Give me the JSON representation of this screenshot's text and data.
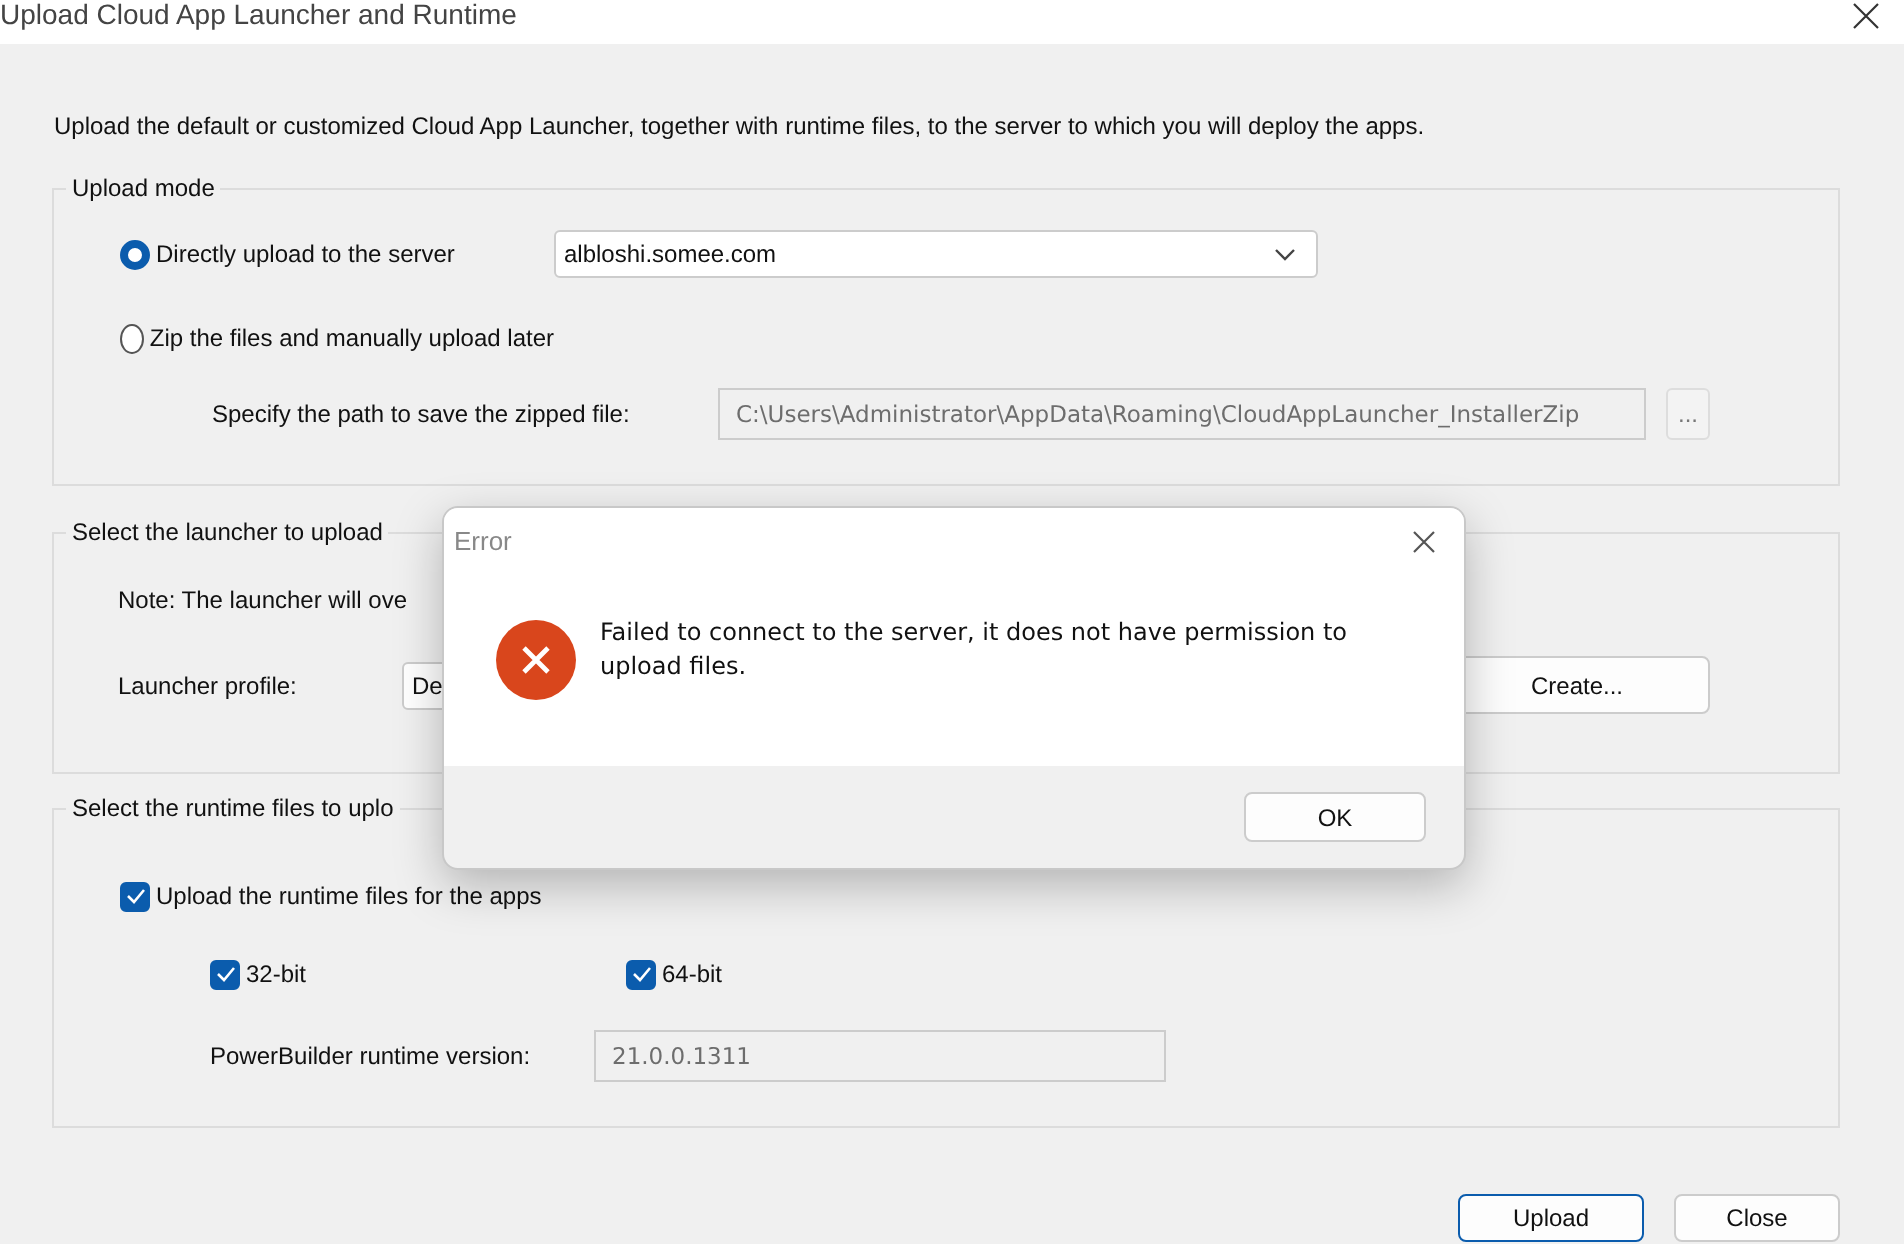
{
  "window": {
    "title": "Upload Cloud App Launcher and Runtime"
  },
  "description": "Upload the default or customized Cloud App Launcher, together with runtime files, to the server to which you will deploy the apps.",
  "upload_mode": {
    "legend": "Upload mode",
    "options": [
      {
        "label": "Directly upload to the server",
        "selected": true
      },
      {
        "label": "Zip the files and manually upload later",
        "selected": false
      }
    ],
    "server": "albloshi.somee.com",
    "path_label": "Specify the path to save the zipped file:",
    "path": "C:\\Users\\Administrator\\AppData\\Roaming\\CloudAppLauncher_InstallerZip",
    "browse": "..."
  },
  "launcher": {
    "legend": "Select the launcher to upload",
    "note": "Note: The launcher will ove",
    "profile_label": "Launcher profile:",
    "profile": "De",
    "create": "Create..."
  },
  "runtime": {
    "legend": "Select the runtime files to uplo",
    "upload_runtime": {
      "label": "Upload the runtime files for the apps",
      "checked": true
    },
    "bits": [
      {
        "label": "32-bit",
        "checked": true
      },
      {
        "label": "64-bit",
        "checked": true
      }
    ],
    "version_label": "PowerBuilder runtime version:",
    "version": "21.0.0.1311"
  },
  "buttons": [
    {
      "label": "Upload",
      "kind": "default"
    },
    {
      "label": "Close",
      "kind": "normal"
    }
  ],
  "error_dialog": {
    "title": "Error",
    "message": "Failed to connect to the server, it does not have permission to upload files.",
    "button": "OK"
  }
}
